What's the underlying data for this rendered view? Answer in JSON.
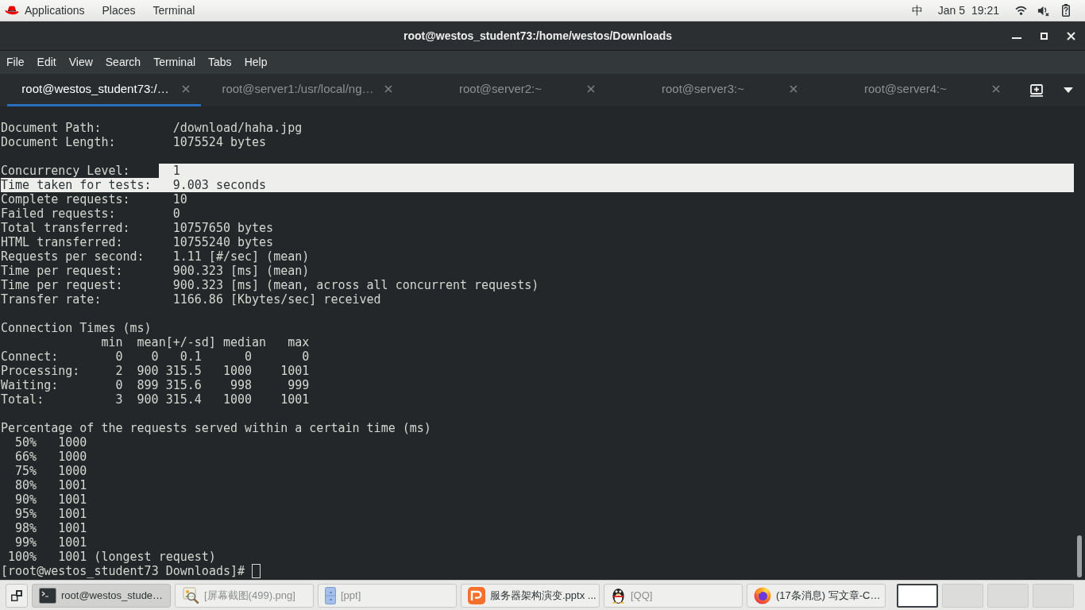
{
  "top_bar": {
    "menus": [
      "Applications",
      "Places",
      "Terminal"
    ],
    "input_method": "中",
    "date": "Jan 5",
    "time": "19:21"
  },
  "window": {
    "title": "root@westos_student73:/home/westos/Downloads"
  },
  "menu_bar": [
    "File",
    "Edit",
    "View",
    "Search",
    "Terminal",
    "Tabs",
    "Help"
  ],
  "tabs": [
    {
      "label": "root@westos_student73:/…",
      "selected": true
    },
    {
      "label": "root@server1:/usr/local/ng…",
      "selected": false
    },
    {
      "label": "root@server2:~",
      "selected": false
    },
    {
      "label": "root@server3:~",
      "selected": false
    },
    {
      "label": "root@server4:~",
      "selected": false
    }
  ],
  "terminal": {
    "lines": [
      {
        "kind": "blank"
      },
      {
        "kind": "field",
        "label": "Document Path:",
        "value": "/download/haha.jpg",
        "label_selected": false,
        "value_selected": false
      },
      {
        "kind": "field",
        "label": "Document Length:",
        "value": "1075524 bytes",
        "label_selected": false,
        "value_selected": false
      },
      {
        "kind": "blank"
      },
      {
        "kind": "field",
        "label": "Concurrency Level:",
        "value": "1",
        "label_selected": false,
        "value_selected": true
      },
      {
        "kind": "field",
        "label": "Time taken for tests:",
        "value": "9.003 seconds",
        "label_selected": true,
        "value_selected": true
      },
      {
        "kind": "field",
        "label": "Complete requests:",
        "value": "10",
        "label_selected": false,
        "value_selected": false
      },
      {
        "kind": "field",
        "label": "Failed requests:",
        "value": "0",
        "label_selected": false,
        "value_selected": false
      },
      {
        "kind": "field",
        "label": "Total transferred:",
        "value": "10757650 bytes",
        "label_selected": false,
        "value_selected": false
      },
      {
        "kind": "field",
        "label": "HTML transferred:",
        "value": "10755240 bytes",
        "label_selected": false,
        "value_selected": false
      },
      {
        "kind": "field",
        "label": "Requests per second:",
        "value": "1.11 [#/sec] (mean)",
        "label_selected": false,
        "value_selected": false
      },
      {
        "kind": "field",
        "label": "Time per request:",
        "value": "900.323 [ms] (mean)",
        "label_selected": false,
        "value_selected": false
      },
      {
        "kind": "field",
        "label": "Time per request:",
        "value": "900.323 [ms] (mean, across all concurrent requests)",
        "label_selected": false,
        "value_selected": false
      },
      {
        "kind": "field",
        "label": "Transfer rate:",
        "value": "1166.86 [Kbytes/sec] received",
        "label_selected": false,
        "value_selected": false
      },
      {
        "kind": "blank"
      },
      {
        "kind": "heading",
        "text": "Connection Times (ms)"
      },
      {
        "kind": "table_header",
        "columns": [
          "min",
          "mean[+/-sd]",
          "median",
          "max"
        ]
      },
      {
        "kind": "table_row",
        "label": "Connect:",
        "cells": [
          "0",
          "0",
          "0.1",
          "0",
          "0"
        ]
      },
      {
        "kind": "table_row",
        "label": "Processing:",
        "cells": [
          "2",
          "900",
          "315.5",
          "1000",
          "1001"
        ]
      },
      {
        "kind": "table_row",
        "label": "Waiting:",
        "cells": [
          "0",
          "899",
          "315.6",
          "998",
          "999"
        ]
      },
      {
        "kind": "table_row",
        "label": "Total:",
        "cells": [
          "3",
          "900",
          "315.4",
          "1000",
          "1001"
        ]
      },
      {
        "kind": "blank"
      },
      {
        "kind": "heading",
        "text": "Percentage of the requests served within a certain time (ms)"
      },
      {
        "kind": "percentile",
        "percent": "50%",
        "time": "1000"
      },
      {
        "kind": "percentile",
        "percent": "66%",
        "time": "1000"
      },
      {
        "kind": "percentile",
        "percent": "75%",
        "time": "1000"
      },
      {
        "kind": "percentile",
        "percent": "80%",
        "time": "1001"
      },
      {
        "kind": "percentile",
        "percent": "90%",
        "time": "1001"
      },
      {
        "kind": "percentile",
        "percent": "95%",
        "time": "1001"
      },
      {
        "kind": "percentile",
        "percent": "98%",
        "time": "1001"
      },
      {
        "kind": "percentile",
        "percent": "99%",
        "time": "1001"
      },
      {
        "kind": "percentile",
        "percent": "100%",
        "time": "1001 (longest request)"
      }
    ],
    "prompt": "[root@westos_student73 Downloads]#"
  },
  "taskbar": {
    "windows": [
      {
        "label": "root@westos_stude…",
        "selected": true,
        "minimized": false
      },
      {
        "label": "[屏幕截图(499).png]",
        "selected": false,
        "minimized": true
      },
      {
        "label": "[ppt]",
        "selected": false,
        "minimized": true
      },
      {
        "label": "服务器架构演变.pptx ...",
        "selected": false,
        "minimized": false
      },
      {
        "label": "[QQ]",
        "selected": false,
        "minimized": true
      },
      {
        "label": "(17条消息) 写文章-C…",
        "selected": false,
        "minimized": false
      }
    ],
    "workspaces": [
      {
        "selected": true
      },
      {
        "selected": false
      },
      {
        "selected": false
      },
      {
        "selected": false
      }
    ]
  }
}
